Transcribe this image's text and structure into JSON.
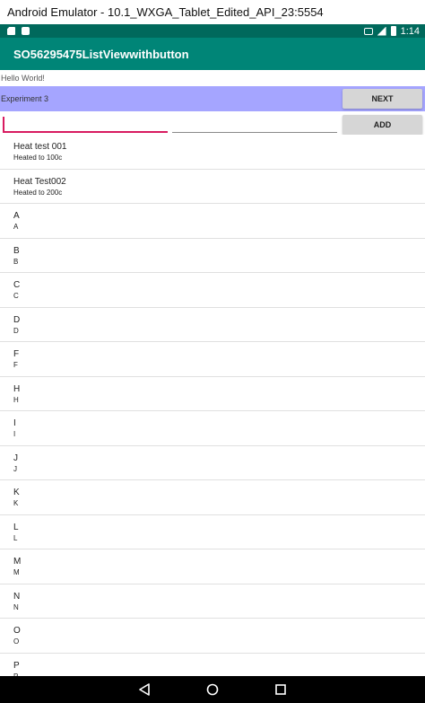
{
  "window": {
    "title": "Android Emulator - 10.1_WXGA_Tablet_Edited_API_23:5554"
  },
  "status_bar": {
    "time": "1:14",
    "icons": [
      "sd-card-icon",
      "notification-icon",
      "no-sim-icon",
      "signal-icon",
      "battery-icon"
    ]
  },
  "app_bar": {
    "title": "SO56295475ListViewwithbutton"
  },
  "hello_text": "Hello World!",
  "experiment": {
    "label": "Experiment 3",
    "next_label": "NEXT"
  },
  "form": {
    "input1_value": "",
    "input2_value": "",
    "add_label": "ADD"
  },
  "list": {
    "items": [
      {
        "title": "Heat test 001",
        "subtitle": "Heated to 100c"
      },
      {
        "title": "Heat Test002",
        "subtitle": "Heated to 200c"
      },
      {
        "title": "A",
        "subtitle": "A"
      },
      {
        "title": "B",
        "subtitle": "B"
      },
      {
        "title": "C",
        "subtitle": "C"
      },
      {
        "title": "D",
        "subtitle": "D"
      },
      {
        "title": "F",
        "subtitle": "F"
      },
      {
        "title": "H",
        "subtitle": "H"
      },
      {
        "title": "I",
        "subtitle": "I"
      },
      {
        "title": "J",
        "subtitle": "J"
      },
      {
        "title": "K",
        "subtitle": "K"
      },
      {
        "title": "L",
        "subtitle": "L"
      },
      {
        "title": "M",
        "subtitle": "M"
      },
      {
        "title": "N",
        "subtitle": "N"
      },
      {
        "title": "O",
        "subtitle": "O"
      },
      {
        "title": "P",
        "subtitle": "P"
      }
    ]
  },
  "nav_bar": {
    "buttons": [
      "back-icon",
      "home-icon",
      "recents-icon"
    ]
  },
  "colors": {
    "status_bar": "#00695c",
    "app_bar": "#008577",
    "experiment_row": "#a5a5ff",
    "input_accent": "#d81b60"
  }
}
